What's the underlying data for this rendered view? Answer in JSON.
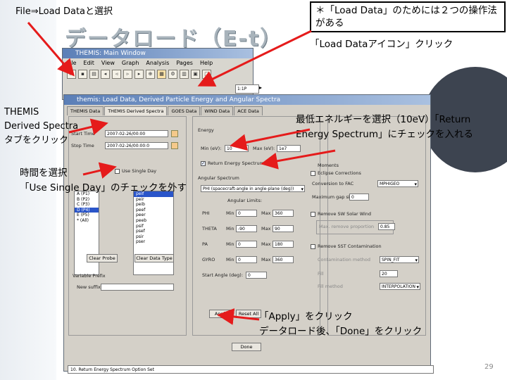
{
  "slide": {
    "breadcrumb": "File⇒Load Dataと選択",
    "title": "データロード（E-t）",
    "callout": "＊「Load Data」のためには２つの操作法がある",
    "note_icon": "「Load Dataアイコン」クリック",
    "note_themis": [
      "THEMIS",
      "Derived Spectra",
      "タブをクリック"
    ],
    "note_energy": "最低エネルギーを選択（10eV）「Return Energy Spectrum」にチェックを入れる",
    "note_time": [
      "時間を選択",
      "「Use Single Day」のチェックを外す"
    ],
    "note_apply": [
      "「Apply」をクリック",
      "データロード後、「Done」をクリック"
    ],
    "page_number": "29"
  },
  "main_window": {
    "title": "THEMIS: Main Window",
    "menu": [
      "File",
      "Edit",
      "View",
      "Graph",
      "Analysis",
      "Pages",
      "Help"
    ],
    "date_value": "1:1P"
  },
  "dialog": {
    "title": "themis: Load Data, Derived Particle Energy and Angular Spectra",
    "tabs": [
      {
        "label": "THEMIS Data"
      },
      {
        "label": "THEMIS Derived Spectra"
      },
      {
        "label": "GOES Data"
      },
      {
        "label": "WIND Data"
      },
      {
        "label": "ACE Data"
      }
    ],
    "left": {
      "start_label": "Start Time",
      "start_value": "2007-02-26/00:00",
      "stop_label": "Stop Time",
      "stop_value": "2007-02-26/00:00:0",
      "single_day_label": "Use Single Day",
      "listbox_items": [
        "A (P1)",
        "B (P2)",
        "C (P3)",
        "D (P4)",
        "E (P5)",
        "* (All)",
        "peif",
        "peir",
        "peib",
        "peef",
        "peer",
        "peeb",
        "psif",
        "psef",
        "psir",
        "pser"
      ],
      "clear_probe": "Clear Probe",
      "clear_data_type": "Clear Data Type",
      "variable_prefix": "Variable Prefix",
      "new_suffix": "New suffix:"
    },
    "mid": {
      "energy_label": "Energy",
      "min_ev_label": "Min (eV):",
      "min_ev_value": "10",
      "max_label": "Max (eV):",
      "max_value": "1e7",
      "return_energy_label": "Return Energy Spectrum",
      "angular_label": "Angular Spectrum",
      "angle_dropdown": "PHI (spacecraft-angle in angle-plane (deg))",
      "angular_limits": "Angular Limits:",
      "rows": [
        {
          "name": "PHI",
          "min": "0",
          "max": "360"
        },
        {
          "name": "THETA",
          "min": "-90",
          "max": "90"
        },
        {
          "name": "PA",
          "min": "0",
          "max": "180"
        },
        {
          "name": "GYRO",
          "min": "0",
          "max": "360"
        }
      ],
      "min_label": "Min",
      "max_label_row": "Max",
      "start_angle_label": "Start Angle (deg):",
      "start_angle_value": "0"
    },
    "right": {
      "moments_label": "Moments",
      "eclipse_label": "Eclipse Corrections",
      "conversion_label": "Conversion to FAC",
      "conversion_value": "MPHIGEO",
      "max_gap_label": "Maximum gap size:",
      "max_gap_value": "0",
      "remove_sw_label": "Remove SW Solar Wind",
      "max_remove_label": "Max. remove proportion",
      "max_remove_value": "0.85",
      "remove_sst_label": "Remove SST Contamination",
      "ugly_method_label": "Contamination method",
      "ugly_method_value": "SPIN_FIT",
      "fill_label": "Fill",
      "fill_value": "20",
      "fill_method_label": "Fill method",
      "fill_method_value": "INTERPOLATION"
    },
    "buttons": {
      "apply": "Apply",
      "reset_all": "Reset All",
      "done": "Done"
    },
    "status": "10. Return Energy Spectrum Option Set"
  }
}
